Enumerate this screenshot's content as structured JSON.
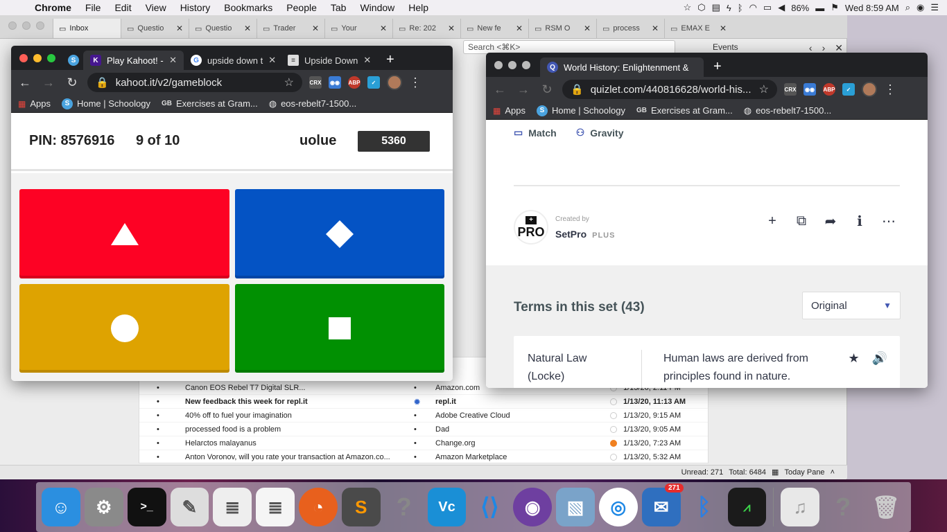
{
  "menubar": {
    "app": "Chrome",
    "menus": [
      "File",
      "Edit",
      "View",
      "History",
      "Bookmarks",
      "People",
      "Tab",
      "Window",
      "Help"
    ],
    "battery": "86%",
    "clock": "Wed 8:59 AM"
  },
  "background_app": {
    "tabs": [
      "Inbox",
      "Questio",
      "Questio",
      "Trader",
      "Your",
      "Re: 202",
      "New fe",
      "RSM O",
      "process",
      "EMAX E"
    ],
    "search_placeholder": "Search <⌘K>",
    "events_label": "Events",
    "messages": [
      {
        "subject": "Canon EOS Rebel T7 Digital SLR...",
        "from": "Amazon.com",
        "date": "1/13/20, 2:11 PM",
        "bold": false
      },
      {
        "subject": "New feedback this week for repl.it",
        "from": "repl.it",
        "date": "1/13/20, 11:13 AM",
        "bold": true
      },
      {
        "subject": "40% off to fuel your imagination",
        "from": "Adobe Creative Cloud",
        "date": "1/13/20, 9:15 AM",
        "bold": false
      },
      {
        "subject": "processed food is a problem",
        "from": "Dad",
        "date": "1/13/20, 9:05 AM",
        "bold": false
      },
      {
        "subject": "Helarctos malayanus",
        "from": "Change.org",
        "date": "1/13/20, 7:23 AM",
        "bold": false
      },
      {
        "subject": "Anton Voronov, will you rate your transaction at Amazon.co...",
        "from": "Amazon Marketplace",
        "date": "1/13/20, 5:32 AM",
        "bold": false
      }
    ],
    "status": {
      "unread": "Unread: 271",
      "total": "Total: 6484",
      "today_pane": "Today Pane"
    }
  },
  "kahoot_window": {
    "tabs": [
      {
        "title": "Play Kahoot! -",
        "active": true
      },
      {
        "title": "upside down t",
        "active": false
      },
      {
        "title": "Upside Down",
        "active": false
      }
    ],
    "url": "kahoot.it/v2/gameblock",
    "bookmarks": [
      "Apps",
      "Home | Schoology",
      "Exercises at Gram...",
      "eos-rebelt7-1500..."
    ],
    "pin": "PIN: 8576916",
    "question": "9 of 10",
    "nickname": "uolue",
    "score": "5360",
    "answers": [
      {
        "shape": "triangle",
        "color": "#e21b3c"
      },
      {
        "shape": "diamond",
        "color": "#1368ce"
      },
      {
        "shape": "circle",
        "color": "#d89e00"
      },
      {
        "shape": "square",
        "color": "#26890c"
      }
    ]
  },
  "quizlet_window": {
    "tab_title": "World History: Enlightenment &",
    "url": "quizlet.com/440816628/world-his...",
    "bookmarks": [
      "Apps",
      "Home | Schoology",
      "Exercises at Gram...",
      "eos-rebelt7-1500..."
    ],
    "study_modes": [
      "Match",
      "Gravity"
    ],
    "created_by": "Created by",
    "creator": "SetPro",
    "creator_tier": "PLUS",
    "pro_badge": "PRO",
    "terms_title": "Terms in this set (43)",
    "sort_option": "Original",
    "card": {
      "term": "Natural Law (Locke)",
      "definition": "Human laws are derived from principles found in nature."
    }
  },
  "dock": {
    "mail_badge": "271",
    "items": [
      "Finder",
      "System Preferences",
      "Terminal",
      "Script Editor",
      "TextEdit",
      "TextEdit 2",
      "Firefox",
      "Sublime Text",
      "Unknown",
      "VNC Viewer",
      "Visual Studio Code",
      "GitHub Desktop",
      "Preview",
      "Google Chrome",
      "Thunderbird",
      "Bluetooth",
      "Activity Monitor",
      "Music",
      "Unknown 2",
      "Trash"
    ]
  }
}
